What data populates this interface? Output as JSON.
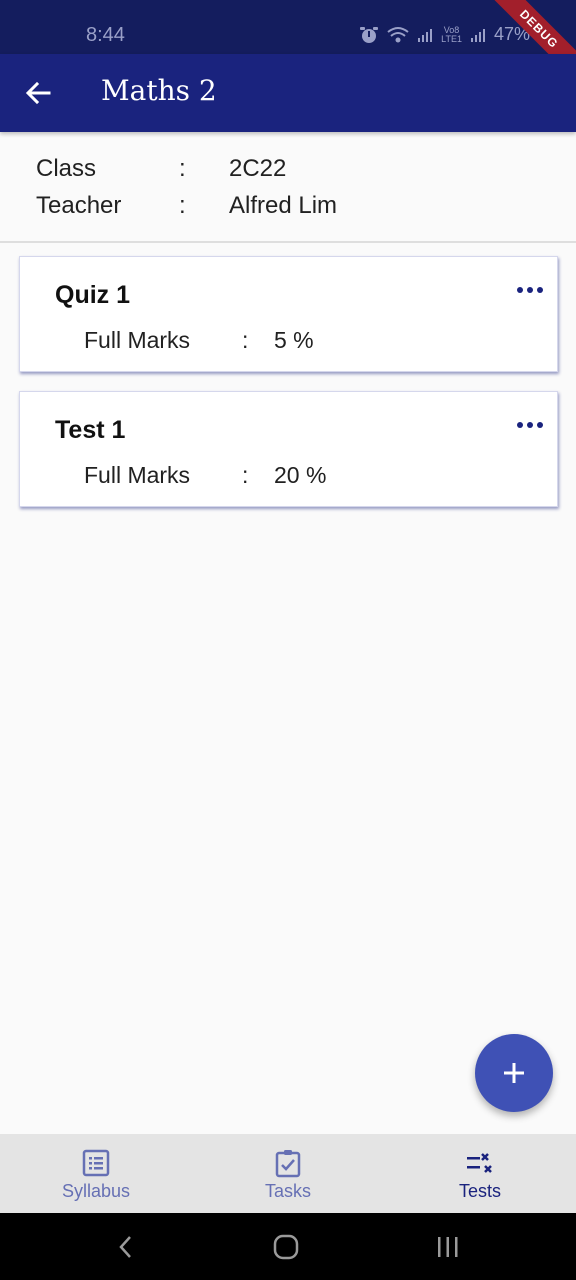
{
  "status_bar": {
    "time": "8:44",
    "carrier_top": "Vo8",
    "carrier_bottom": "LTE1",
    "battery": "47%"
  },
  "debug_banner": "DEBUG",
  "app_bar": {
    "title": "Maths 2",
    "back_icon": "arrow-back-icon"
  },
  "info": {
    "separator": ":",
    "rows": [
      {
        "label": "Class",
        "value": "2C22"
      },
      {
        "label": "Teacher",
        "value": "Alfred Lim"
      }
    ]
  },
  "tests": [
    {
      "title": "Quiz 1",
      "label": "Full Marks",
      "separator": ":",
      "value": "5 %"
    },
    {
      "title": "Test 1",
      "label": "Full Marks",
      "separator": ":",
      "value": "20 %"
    }
  ],
  "fab": {
    "icon": "plus-icon"
  },
  "bottom_nav": {
    "items": [
      {
        "label": "Syllabus",
        "icon": "list-icon",
        "active": false
      },
      {
        "label": "Tasks",
        "icon": "clipboard-check-icon",
        "active": false
      },
      {
        "label": "Tests",
        "icon": "checklist-icon",
        "active": true
      }
    ]
  },
  "colors": {
    "primary": "#1a237e",
    "status_bar": "#141d5e",
    "accent": "#3f51b5",
    "inactive_nav": "#6670b4",
    "debug": "#a21f2b"
  }
}
